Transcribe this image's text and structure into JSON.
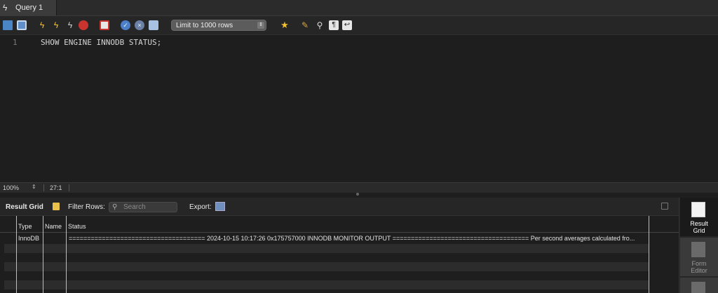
{
  "tab": {
    "title": "Query 1"
  },
  "toolbar": {
    "limit_select": "Limit to 1000 rows"
  },
  "editor": {
    "line_number": "1",
    "sql": "SHOW ENGINE INNODB STATUS;"
  },
  "status": {
    "zoom": "100%",
    "cursor": "27:1"
  },
  "result_toolbar": {
    "title": "Result Grid",
    "filter_label": "Filter Rows:",
    "search_placeholder": "Search",
    "export_label": "Export:"
  },
  "grid": {
    "columns": [
      "Type",
      "Name",
      "Status"
    ],
    "rows": [
      {
        "type": "InnoDB",
        "name": "",
        "status": "===================================== 2024-10-15 10:17:26 0x175757000 INNODB MONITOR OUTPUT ===================================== Per second averages calculated fro..."
      }
    ]
  },
  "right_panel": {
    "result_grid": "Result\nGrid",
    "form_editor": "Form\nEditor"
  },
  "icons": [
    "lightning-icon",
    "open-folder-icon",
    "save-icon",
    "execute-icon",
    "execute-current-icon",
    "explain-icon",
    "stop-icon",
    "toggle-error-icon",
    "commit-icon",
    "rollback-icon",
    "autocommit-icon",
    "bookmark-star-icon",
    "beautify-icon",
    "find-icon",
    "invisible-chars-icon",
    "wrap-lines-icon"
  ],
  "colors": {
    "background": "#1e1e1e",
    "toolbar": "#262626",
    "accent_yellow": "#f2c12e",
    "stop_red": "#c9342f",
    "commit_blue": "#4d7fc9"
  }
}
